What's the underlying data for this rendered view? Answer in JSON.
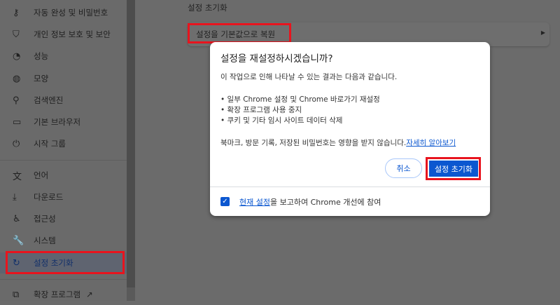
{
  "sidebar": {
    "items": [
      {
        "label": "자동 완성 및 비밀번호",
        "icon": "key-icon",
        "glyph": "⚷"
      },
      {
        "label": "개인 정보 보호 및 보안",
        "icon": "shield-icon",
        "glyph": "⛉"
      },
      {
        "label": "성능",
        "icon": "speedometer-icon",
        "glyph": "◔"
      },
      {
        "label": "모양",
        "icon": "palette-icon",
        "glyph": "◍"
      },
      {
        "label": "검색엔진",
        "icon": "search-icon",
        "glyph": "⚲"
      },
      {
        "label": "기본 브라우저",
        "icon": "browser-icon",
        "glyph": "▭"
      },
      {
        "label": "시작 그룹",
        "icon": "power-icon",
        "glyph": "⏻"
      },
      {
        "label": "언어",
        "icon": "translate-icon",
        "glyph": "文"
      },
      {
        "label": "다운로드",
        "icon": "download-icon",
        "glyph": "⤓"
      },
      {
        "label": "접근성",
        "icon": "accessibility-icon",
        "glyph": "♿"
      },
      {
        "label": "시스템",
        "icon": "wrench-icon",
        "glyph": "🔧"
      },
      {
        "label": "설정 초기화",
        "icon": "reset-icon",
        "glyph": "↻"
      },
      {
        "label": "확장 프로그램",
        "icon": "extension-icon",
        "glyph": "⧉"
      }
    ]
  },
  "main": {
    "section_title": "설정 초기화",
    "card_label": "설정을 기본값으로 복원",
    "card_arrow": "▶"
  },
  "dialog": {
    "title": "설정을 재설정하시겠습니까?",
    "intro": "이 작업으로 인해 나타날 수 있는 결과는 다음과 같습니다.",
    "bullets": [
      "• 일부 Chrome 설정 및 Chrome 바로가기 재설정",
      "• 확장 프로그램 사용 중지",
      "• 쿠키 및 기타 임시 사이트 데이터 삭제"
    ],
    "note": "북마크, 방문 기록, 저장된 비밀번호는 영향을 받지 않습니다.",
    "learn_more": "자세히 알아보기",
    "cancel": "취소",
    "confirm": "설정 초기화",
    "checkbox_link": "현재 설정",
    "checkbox_text": "을 보고하여 Chrome 개선에 참여",
    "checkbox_checked": true
  }
}
